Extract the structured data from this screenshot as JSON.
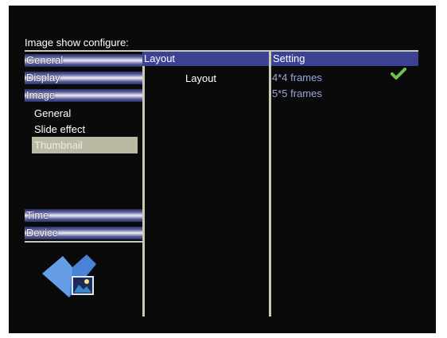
{
  "title": "Image show configure:",
  "menu": {
    "general": "General",
    "display": "Display",
    "image": "Image",
    "image_sub": {
      "general": "General",
      "slide_effect": "Slide effect",
      "thumbnail": "Thumbnail"
    },
    "time": "Time",
    "device": "Device"
  },
  "middle": {
    "header": "Layout",
    "item": "Layout"
  },
  "right": {
    "header": "Setting",
    "options": [
      "4*4 frames",
      "5*5 frames"
    ],
    "selected_option": "4*4 frames"
  },
  "icons": {
    "check": "check-icon",
    "logo": "photo-album-icon"
  },
  "colors": {
    "background": "#0a0a0a",
    "header_bar": "#3b4293",
    "option_text": "#9aa6dc",
    "check": "#6cc24a",
    "divider": "#c9c9b4",
    "selected_item": "#b9b9a4"
  }
}
